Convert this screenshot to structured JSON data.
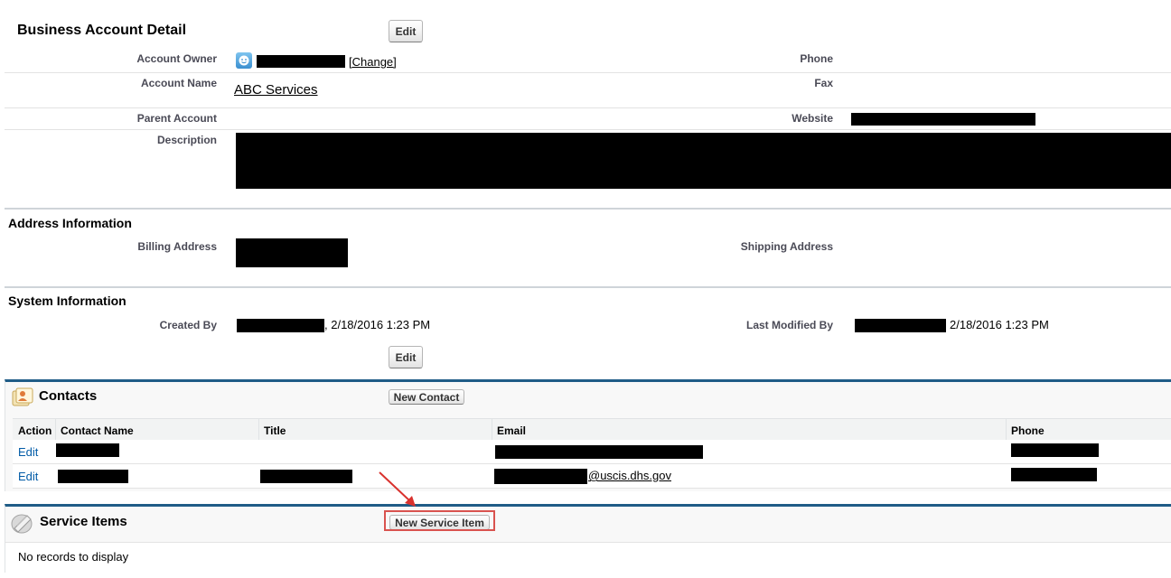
{
  "detail": {
    "title": "Business Account Detail",
    "edit_label": "Edit",
    "fields": {
      "account_owner_label": "Account Owner",
      "account_owner_change": "[Change]",
      "phone_label": "Phone",
      "account_name_label": "Account Name",
      "account_name_value": "ABC Services",
      "fax_label": "Fax",
      "parent_account_label": "Parent Account",
      "website_label": "Website",
      "description_label": "Description"
    }
  },
  "address": {
    "title": "Address Information",
    "billing_label": "Billing Address",
    "shipping_label": "Shipping Address"
  },
  "system": {
    "title": "System Information",
    "created_by_label": "Created By",
    "created_by_date": ", 2/18/2016 1:23 PM",
    "last_modified_label": "Last Modified By",
    "last_modified_date": "2/18/2016 1:23 PM",
    "edit_label": "Edit"
  },
  "contacts": {
    "title": "Contacts",
    "new_button": "New Contact",
    "columns": [
      "Action",
      "Contact Name",
      "Title",
      "Email",
      "Phone"
    ],
    "rows": [
      {
        "action": "Edit",
        "email_suffix": ""
      },
      {
        "action": "Edit",
        "email_suffix": "@uscis.dhs.gov"
      }
    ]
  },
  "service_items": {
    "title": "Service Items",
    "new_button": "New Service Item",
    "empty_text": "No records to display"
  },
  "colors": {
    "panel_border": "#1f5c87",
    "highlight_box": "#d9534f",
    "arrow": "#d9312d"
  },
  "icons": [
    "account-owner-avatar-icon",
    "contacts-icon",
    "service-items-icon",
    "annotation-arrow"
  ]
}
